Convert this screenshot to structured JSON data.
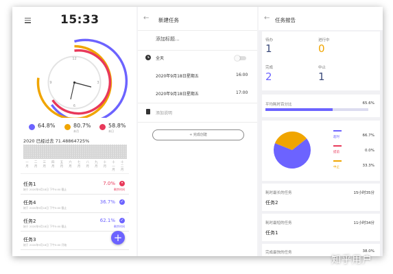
{
  "clock_screen": {
    "time": "15:33",
    "clock_numbers": [
      "12",
      "3",
      "6",
      "9"
    ],
    "stats": [
      {
        "value": "64.8%",
        "sub": "",
        "color": "#6c63ff"
      },
      {
        "value": "80.7%",
        "sub": "本月",
        "color": "#f0a500"
      },
      {
        "value": "58.8%",
        "sub": "本日",
        "color": "#e8395a"
      }
    ],
    "year_progress": "2020 已经过去 71.48864725%",
    "months": [
      "一月",
      "二月",
      "三月",
      "四月",
      "五月",
      "六月",
      "七月",
      "八月",
      "九月",
      "十月",
      "十一月",
      "十二月"
    ],
    "tasks": [
      {
        "name": "任务1",
        "date": "始于 2020年9月18日 下午4:00 截止",
        "pct": "7.0%",
        "status": "剩余时间",
        "color": "#e8395a"
      },
      {
        "name": "任务4",
        "date": "始于 2020年9月18日 下午5:00 截止",
        "pct": "36.7%",
        "status": "",
        "color": "#6c63ff"
      },
      {
        "name": "任务2",
        "date": "始于 2020年9月18日 下午5:00 截止",
        "pct": "62.1%",
        "status": "剩余时间",
        "color": "#6c63ff"
      },
      {
        "name": "任务3",
        "date": "始于 2020年9月18日 下午5:00 开始",
        "pct": "",
        "status": "",
        "color": "#6c63ff"
      }
    ],
    "fab": "+"
  },
  "new_task": {
    "title": "新建任务",
    "title_placeholder": "添加标题...",
    "all_day": "全天",
    "start_date": "2020年9月18日星期五",
    "start_time": "16:00",
    "end_date": "2020年9月18日星期五",
    "end_time": "17:00",
    "note_placeholder": "添加说明",
    "save_button": "+ 完成创建"
  },
  "report": {
    "title": "任务报告",
    "counts": [
      {
        "label": "待办",
        "value": "1",
        "color": "#3b4a7a"
      },
      {
        "label": "进行中",
        "value": "0",
        "color": "#f0a500"
      },
      {
        "label": "完成",
        "value": "2",
        "color": "#6c63ff"
      },
      {
        "label": "中止",
        "value": "1",
        "color": "#3b4a7a"
      }
    ],
    "avg_label": "平均耗时百分比",
    "avg_value": "65.6%",
    "avg_fraction": 0.656,
    "pie_legend": [
      {
        "label": "超时",
        "value": "66.7%",
        "color": "#6c63ff",
        "fraction": 0.667
      },
      {
        "label": "提前",
        "value": "0.0%",
        "color": "#e8395a",
        "fraction": 0.0
      },
      {
        "label": "中止",
        "value": "33.3%",
        "color": "#f0a500",
        "fraction": 0.333
      }
    ],
    "longest_label": "耗时最长的任务",
    "longest_value": "15小时35分",
    "longest_name": "任务2",
    "shortest_label": "耗时最短的任务",
    "shortest_value": "11小时34分",
    "shortest_name": "任务1",
    "completion_label": "完成最快的任务",
    "completion_value": "38.0%"
  },
  "watermark": "知乎用户"
}
